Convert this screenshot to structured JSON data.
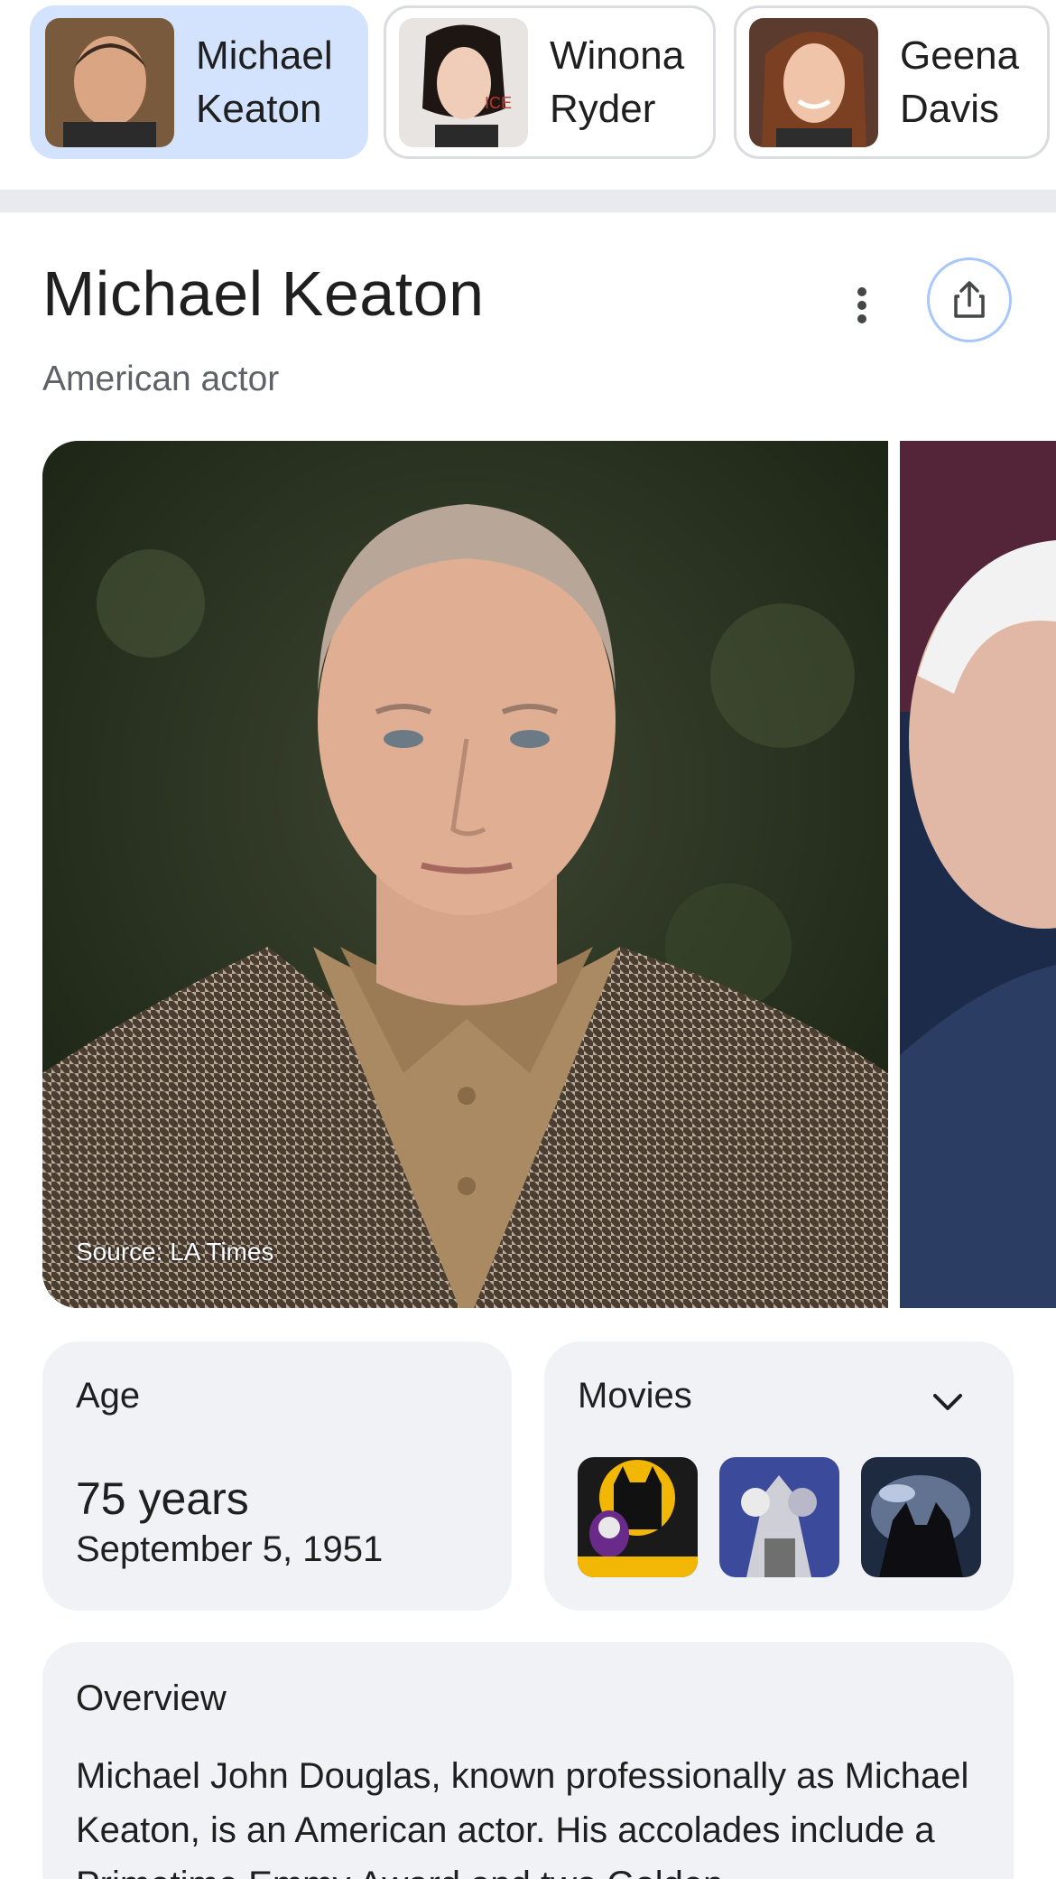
{
  "chips": [
    {
      "first": "Michael",
      "last": "Keaton",
      "active": true
    },
    {
      "first": "Winona",
      "last": "Ryder",
      "active": false
    },
    {
      "first": "Geena",
      "last": "Davis",
      "active": false
    }
  ],
  "header": {
    "title": "Michael Keaton",
    "subtitle": "American actor"
  },
  "icons": {
    "more": "more-vert-icon",
    "share": "share-icon",
    "expand": "chevron-down-icon"
  },
  "gallery": {
    "source": "Source: LA Times"
  },
  "age_card": {
    "label": "Age",
    "value": "75 years",
    "date": "September 5, 1951"
  },
  "movies_card": {
    "label": "Movies"
  },
  "overview": {
    "label": "Overview",
    "text": "Michael John Douglas, known professionally as Michael Keaton, is an American actor. His accolades include a Primetime Emmy Award and two Golden"
  },
  "colors": {
    "active_chip": "#d3e3fd",
    "card_bg": "#f0f2f5",
    "share_ring": "#a8c7fa"
  }
}
